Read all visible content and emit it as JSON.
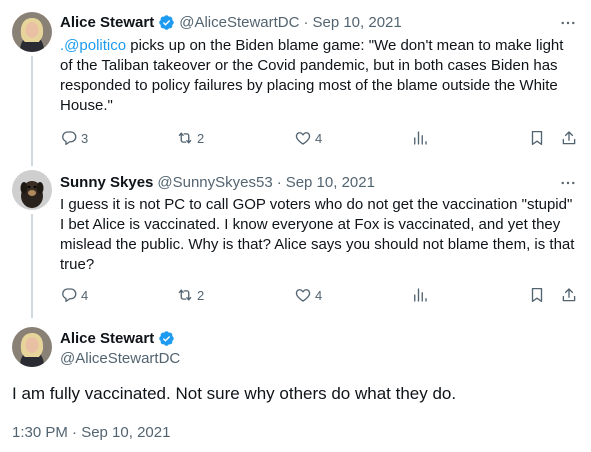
{
  "tweets": [
    {
      "name": "Alice Stewart",
      "handle": "@AliceStewartDC",
      "sep": "·",
      "date": "Sep 10, 2021",
      "mention": ".@politico",
      "line1_rest": " picks up on the Biden blame game: \"We don't mean to make light",
      "line2": "of the Taliban takeover or the Covid pandemic, but in both cases Biden has",
      "line3": "responded to policy failures by placing most of the blame outside the White",
      "line4": "House.\"",
      "replies": "3",
      "retweets": "2",
      "likes": "4"
    },
    {
      "name": "Sunny Skyes",
      "handle": "@SunnySkyes53",
      "sep": "·",
      "date": "Sep 10, 2021",
      "line1": "I guess it is not PC to call GOP voters who do not get the vaccination \"stupid\"",
      "line2": "I bet Alice is vaccinated. I know everyone at Fox is vaccinated, and yet they",
      "line3": "mislead the public. Why is that? Alice says you should not blame them, is that",
      "line4": "true?",
      "replies": "4",
      "retweets": "2",
      "likes": "4"
    }
  ],
  "main_tweet": {
    "name": "Alice Stewart",
    "handle": "@AliceStewartDC",
    "text": "I am fully vaccinated. Not sure why others do what they do.",
    "timestamp": "1:30 PM · Sep 10, 2021"
  },
  "colors": {
    "verified_blue": "#1d9bf0",
    "secondary_text": "#536471",
    "link": "#1d9bf0"
  },
  "icons": [
    "verified-badge-icon",
    "more-icon",
    "reply-icon",
    "retweet-icon",
    "like-icon",
    "views-icon",
    "bookmark-icon",
    "share-icon"
  ]
}
